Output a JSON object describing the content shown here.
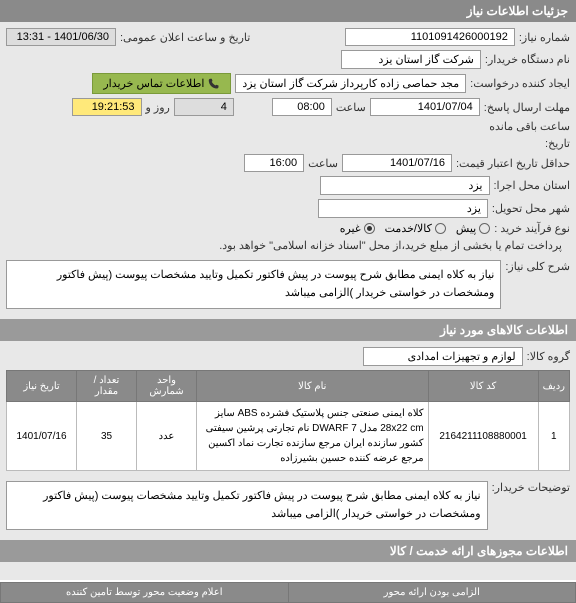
{
  "headers": {
    "need_details": "جزئیات اطلاعات نیاز",
    "goods_info": "اطلاعات کالاهای مورد نیاز",
    "service_permits": "اطلاعات مجوزهای ارائه خدمت / کالا"
  },
  "labels": {
    "need_number": "شماره نیاز:",
    "org_name": "نام دستگاه خریدار:",
    "announce_datetime": "تاریخ و ساعت اعلان عمومی:",
    "requester": "ایجاد کننده درخواست:",
    "deadline_send": "مهلت ارسال پاسخ:",
    "hour": "ساعت",
    "day_and": "روز و",
    "time_remaining": "ساعت باقی مانده",
    "date": "تاریخ:",
    "credit_expire": "حداقل تاریخ اعتبار قیمت:",
    "exec_province": "استان محل اجرا:",
    "deliver_city": "شهر محل تحویل:",
    "process_type": "نوع فرآیند خرید :",
    "need_desc": "شرح کلی نیاز:",
    "goods_group": "گروه کالا:",
    "buyer_notes": "توضیحات خریدار:",
    "mandatory_axis": "الزامی بودن ارائه محور",
    "axis_status_desc": "اعلام وضعیت محور توسط تامین کننده"
  },
  "values": {
    "need_number": "1101091426000192",
    "announce_datetime": "1401/06/30 - 13:31",
    "org_name": "شرکت گاز استان یزد",
    "requester": "مجد حماصی زاده کارپرداز شرکت گاز استان یزد",
    "contact_button": "اطلاعات تماس خریدار",
    "deadline_date": "1401/07/04",
    "deadline_time": "08:00",
    "remaining_days": "4",
    "remaining_time": "19:21:53",
    "credit_date": "1401/07/16",
    "credit_time": "16:00",
    "exec_province": "یزد",
    "deliver_city": "یزد",
    "need_desc": "نیاز به کلاه ایمنی مطابق شرح پیوست در پیش فاکتور تکمیل وتایید مشخصات پیوست (پیش فاکتور ومشخصات در خواستی خریدار )الزامی میباشد",
    "goods_group": "لوازم و تجهیزات امدادی",
    "buyer_notes": "نیاز به کلاه ایمنی مطابق شرح پیوست در پیش فاکتور تکمیل وتایید مشخصات پیوست (پیش فاکتور ومشخصات در خواستی خریدار )الزامی میباشد"
  },
  "process_options": {
    "predict": "پیش",
    "goods_service": "کالا/خدمت",
    "other": "غیره"
  },
  "process_note": "پرداخت تمام یا بخشی از مبلع خرید،از محل \"اسناد خزانه اسلامی\" خواهد بود.",
  "table": {
    "headers": {
      "row": "ردیف",
      "code": "کد کالا",
      "name": "نام کالا",
      "unit": "واحد شمارش",
      "qty": "تعداد / مقدار",
      "date": "تاریخ نیاز"
    },
    "rows": [
      {
        "row": "1",
        "code": "2164211108880001",
        "name": "کلاه ایمنی صنعتی جنس پلاستیک فشرده ABS سایز 28x22 cm مدل DWARF 7 نام تجارتی پرشین سیفتی کشور سازنده ایران مرجع سازنده تجارت نماد اکسین مرجع عرضه کننده حسین بشیرزاده",
        "unit": "عدد",
        "qty": "35",
        "date": "1401/07/16"
      }
    ]
  }
}
